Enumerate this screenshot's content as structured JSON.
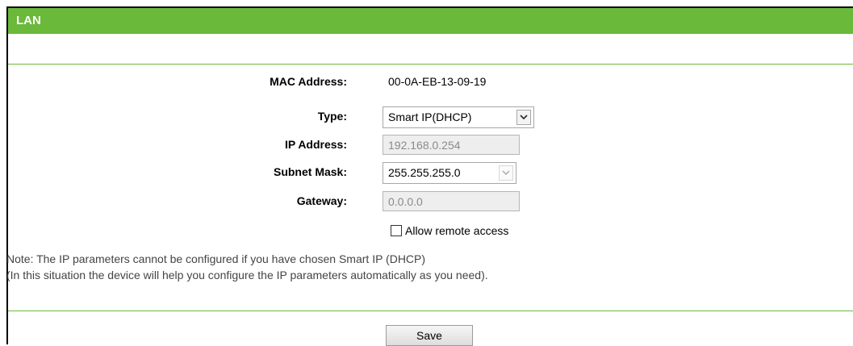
{
  "panel": {
    "title": "LAN"
  },
  "form": {
    "mac_label": "MAC Address:",
    "mac_value": "00-0A-EB-13-09-19",
    "type_label": "Type:",
    "type_value": "Smart IP(DHCP)",
    "ip_label": "IP Address:",
    "ip_value": "192.168.0.254",
    "mask_label": "Subnet Mask:",
    "mask_value": "255.255.255.0",
    "gateway_label": "Gateway:",
    "gateway_value": "0.0.0.0",
    "remote_access_label": "Allow remote access",
    "remote_access_checked": false
  },
  "notes": {
    "line1": "Note: The IP parameters cannot be configured if you have chosen Smart IP (DHCP)",
    "line2": "(In this situation the device will help you configure the IP parameters automatically as you need)."
  },
  "actions": {
    "save_label": "Save"
  },
  "colors": {
    "accent": "#6ab93b"
  },
  "icons": {
    "dropdown": "chevron-down-icon"
  }
}
